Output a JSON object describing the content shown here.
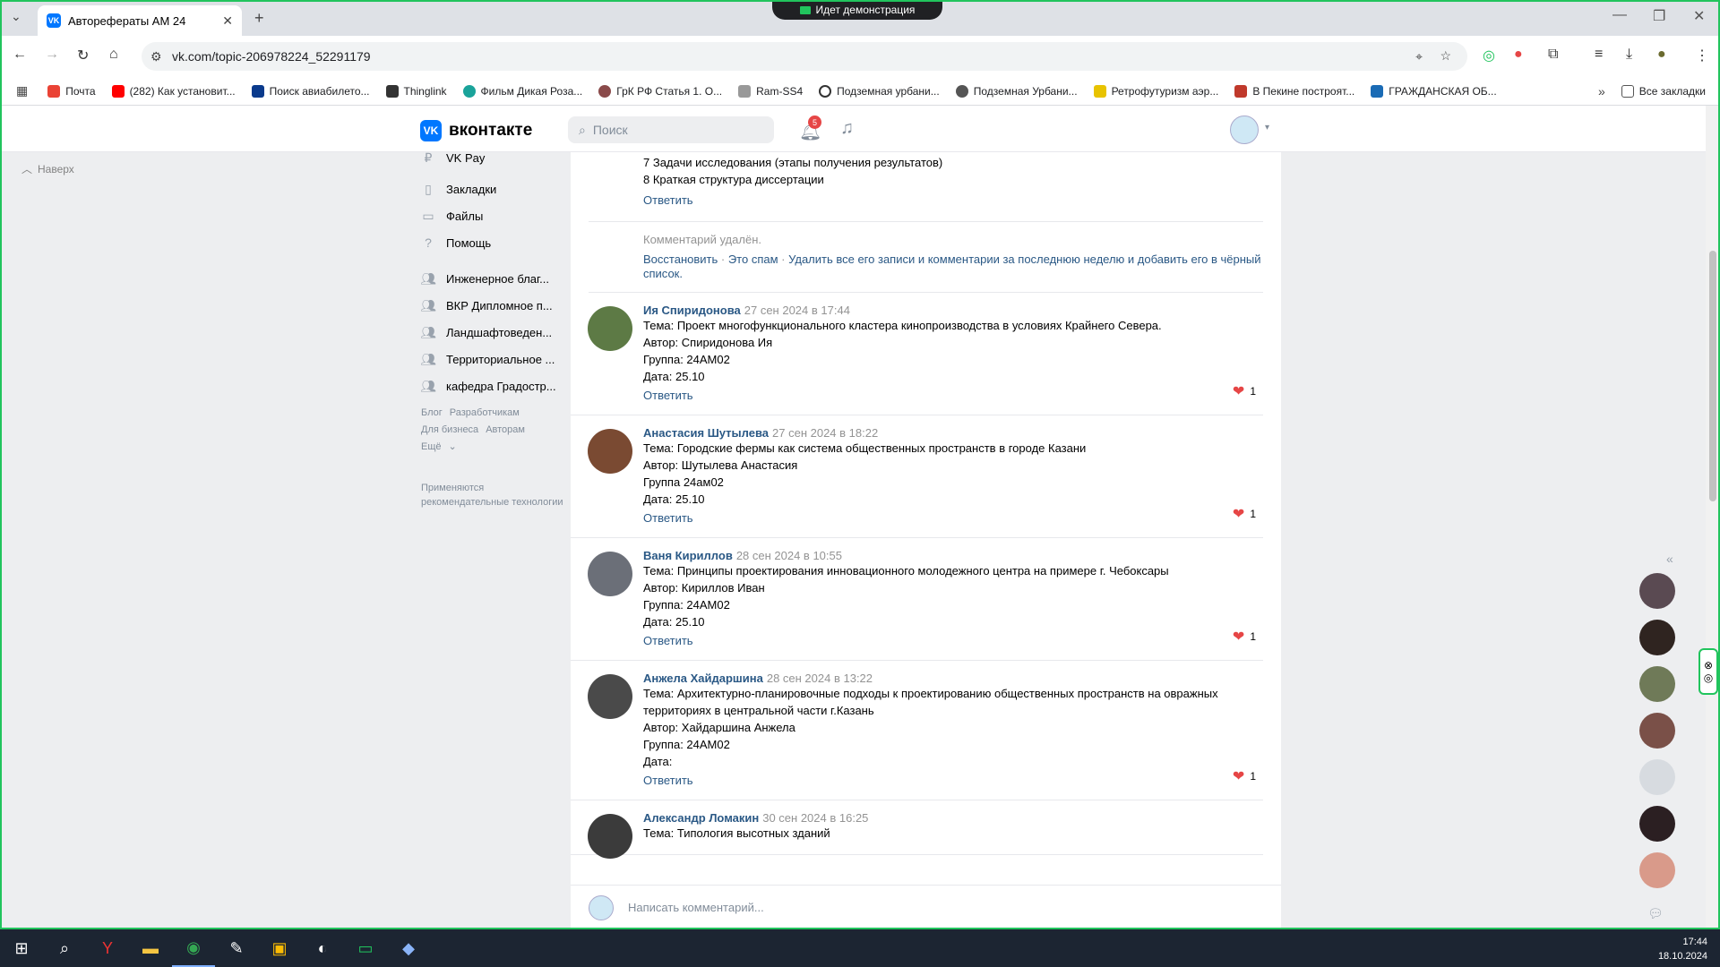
{
  "browser": {
    "tab_title": "Авторефераты АМ 24",
    "screen_share": "Идет демонстрация",
    "url": "vk.com/topic-206978224_52291179",
    "bookmarks": [
      "Почта",
      "(282) Как установит...",
      "Поиск авиабилето...",
      "Thinglink",
      "Фильм Дикая Роза...",
      "ГрК РФ Статья 1. О...",
      "Ram-SS4",
      "Подземная урбани...",
      "Подземная Урбани...",
      "Ретрофутуризм аэр...",
      "В Пекине построят...",
      "ГРАЖДАНСКАЯ ОБ..."
    ],
    "all_bookmarks": "Все закладки"
  },
  "header": {
    "logo": "вконтакте",
    "search_placeholder": "Поиск",
    "notif_count": "5"
  },
  "up_label": "Наверх",
  "sidebar": {
    "top": "VK Pay",
    "items": [
      "Закладки",
      "Файлы",
      "Помощь"
    ],
    "groups": [
      "Инженерное благ...",
      "ВКР Дипломное п...",
      "Ландшафтоведен...",
      "Территориальное ...",
      "кафедра Градостр..."
    ],
    "footer": [
      "Блог",
      "Разработчикам",
      "Для бизнеса",
      "Авторам",
      "Ещё"
    ],
    "reco": "Применяются рекомендательные технологии"
  },
  "main": {
    "frag_lines": [
      "7 Задачи исследования (этапы получения результатов)",
      "8 Краткая структура диссертации"
    ],
    "reply": "Ответить",
    "deleted": {
      "text": "Комментарий удалён.",
      "restore": "Восстановить",
      "spam": "Это спам",
      "delete_all": "Удалить все его записи и комментарии за последнюю неделю и добавить его в чёрный список."
    },
    "comments": [
      {
        "author": "Ия Спиридонова",
        "date": "27 сен 2024 в 17:44",
        "lines": [
          "Тема: Проект многофункционального кластера кинопроизводства в условиях Крайнего Севера.",
          "Автор: Спиридонова Ия",
          "Группа: 24АМ02",
          "Дата: 25.10"
        ],
        "likes": "1"
      },
      {
        "author": "Анастасия Шутылева",
        "date": "27 сен 2024 в 18:22",
        "lines": [
          "Тема: Городские фермы как система общественных пространств в городе Казани",
          "Автор: Шутылева Анастасия",
          "Группа 24ам02",
          "Дата: 25.10"
        ],
        "likes": "1"
      },
      {
        "author": "Ваня Кириллов",
        "date": "28 сен 2024 в 10:55",
        "lines": [
          "Тема: Принципы проектирования инновационного молодежного центра на примере г. Чебоксары",
          "Автор: Кириллов Иван",
          "Группа: 24АМ02",
          "Дата: 25.10"
        ],
        "likes": "1"
      },
      {
        "author": "Анжела Хайдаршина",
        "date": "28 сен 2024 в 13:22",
        "lines": [
          "Тема: Архитектурно-планировочные подходы к проектированию общественных пространств на овражных территориях в центральной части г.Казань",
          "Автор: Хайдаршина Анжела",
          "Группа: 24АМ02",
          "Дата:"
        ],
        "likes": "1"
      },
      {
        "author": "Александр Ломакин",
        "date": "30 сен 2024 в 16:25",
        "lines": [
          "Тема: Типология высотных зданий"
        ],
        "likes": ""
      }
    ],
    "composer_placeholder": "Написать комментарий..."
  },
  "taskbar": {
    "time": "17:44",
    "date": "18.10.2024"
  },
  "colors": {
    "vk_blue": "#0077ff",
    "link": "#2a5885",
    "heart": "#e64646",
    "share_frame": "#21c45d"
  }
}
